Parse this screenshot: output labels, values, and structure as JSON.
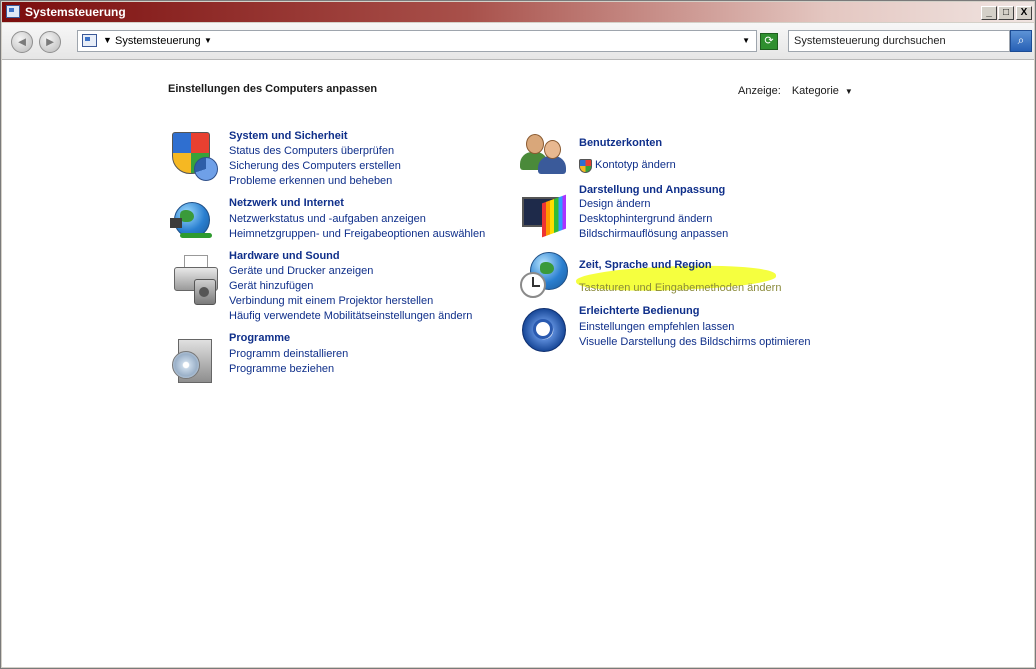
{
  "window": {
    "title": "Systemsteuerung",
    "minimize": "_",
    "maximize": "□",
    "close": "X"
  },
  "toolbar": {
    "back": "◄",
    "forward": "►",
    "breadcrumb": "Systemsteuerung",
    "search_placeholder": "Systemsteuerung durchsuchen"
  },
  "content": {
    "heading": "Einstellungen des Computers anpassen",
    "view_label": "Anzeige:",
    "view_value": "Kategorie"
  },
  "categories": [
    {
      "title": "System und Sicherheit",
      "links": [
        "Status des Computers überprüfen",
        "Sicherung des Computers erstellen",
        "Probleme erkennen und beheben"
      ]
    },
    {
      "title": "Netzwerk und Internet",
      "links": [
        "Netzwerkstatus und -aufgaben anzeigen",
        "Heimnetzgruppen- und Freigabeoptionen auswählen"
      ]
    },
    {
      "title": "Hardware und Sound",
      "links": [
        "Geräte und Drucker anzeigen",
        "Gerät hinzufügen",
        "Verbindung mit einem Projektor herstellen",
        "Häufig verwendete Mobilitätseinstellungen ändern"
      ]
    },
    {
      "title": "Programme",
      "links": [
        "Programm deinstallieren",
        "Programme beziehen"
      ]
    },
    {
      "title": "Benutzerkonten",
      "links": [
        "Kontotyp ändern"
      ]
    },
    {
      "title": "Darstellung und Anpassung",
      "links": [
        "Design ändern",
        "Desktophintergrund ändern",
        "Bildschirmauflösung anpassen"
      ]
    },
    {
      "title": "Zeit, Sprache und Region",
      "links": [
        "Tastaturen und Eingabemethoden ändern"
      ]
    },
    {
      "title": "Erleichterte Bedienung",
      "links": [
        "Einstellungen empfehlen lassen",
        "Visuelle Darstellung des Bildschirms optimieren"
      ]
    }
  ],
  "colors": {
    "link": "#0f2f8a",
    "highlight": "#f4ff2a",
    "titlebar": "#7b0d0d"
  }
}
